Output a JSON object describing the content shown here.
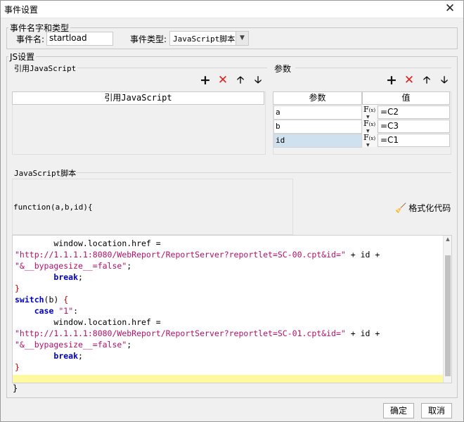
{
  "window": {
    "title": "事件设置",
    "close_glyph": "✕"
  },
  "event_group": {
    "legend": "事件名字和类型",
    "name_label": "事件名:",
    "name_value": "startload",
    "type_label": "事件类型:",
    "type_value": "JavaScript脚本"
  },
  "js_group": {
    "legend": "JS设置",
    "ref_section": {
      "title": "引用JavaScript",
      "column_header": "引用JavaScript",
      "items": []
    },
    "param_section": {
      "title": "参数",
      "columns": [
        "参数",
        "值"
      ],
      "rows": [
        {
          "name": "a",
          "value": "=C2",
          "selected": false
        },
        {
          "name": "b",
          "value": "=C3",
          "selected": false
        },
        {
          "name": "id",
          "value": "=C1",
          "selected": true
        }
      ]
    },
    "toolbar": {
      "add": "+",
      "delete": "✕",
      "up": "🡡",
      "down": "🡣"
    },
    "script_section": {
      "title": "JavaScript脚本",
      "function_header": "function(a,b,id){",
      "format_button": "格式化代码",
      "closing_brace": "}"
    }
  },
  "code_lines": [
    [
      {
        "t": "        window.location.href = "
      }
    ],
    [
      {
        "t": "\"http://1.1.1.1:8080/WebReport/ReportServer?reportlet=SC-00.cpt&id=\"",
        "c": "str"
      },
      {
        "t": " + id +"
      }
    ],
    [
      {
        "t": "\"&__bypagesize__=false\"",
        "c": "str"
      },
      {
        "t": ";"
      }
    ],
    [
      {
        "t": "        "
      },
      {
        "t": "break",
        "c": "kw"
      },
      {
        "t": ";"
      }
    ],
    [
      {
        "t": "}",
        "c": "br"
      }
    ],
    [
      {
        "t": "switch",
        "c": "kw"
      },
      {
        "t": "(b) "
      },
      {
        "t": "{",
        "c": "br"
      }
    ],
    [
      {
        "t": "    "
      },
      {
        "t": "case",
        "c": "kw"
      },
      {
        "t": " "
      },
      {
        "t": "\"1\"",
        "c": "str"
      },
      {
        "t": ":"
      }
    ],
    [
      {
        "t": "        window.location.href = "
      }
    ],
    [
      {
        "t": "\"http://1.1.1.1:8080/WebReport/ReportServer?reportlet=SC-01.cpt&id=\"",
        "c": "str"
      },
      {
        "t": " + id +"
      }
    ],
    [
      {
        "t": "\"&__bypagesize__=false\"",
        "c": "str"
      },
      {
        "t": ";"
      }
    ],
    [
      {
        "t": "        "
      },
      {
        "t": "break",
        "c": "kw"
      },
      {
        "t": ";"
      }
    ],
    [
      {
        "t": "}",
        "c": "br"
      }
    ]
  ],
  "footer": {
    "ok_label": "确定",
    "cancel_label": "取消"
  },
  "colors": {
    "accent_delete": "#e02020",
    "selected_row": "#cfe0ee",
    "current_line": "#fffaa0",
    "keyword": "#0000c0",
    "string": "#b0126a"
  }
}
